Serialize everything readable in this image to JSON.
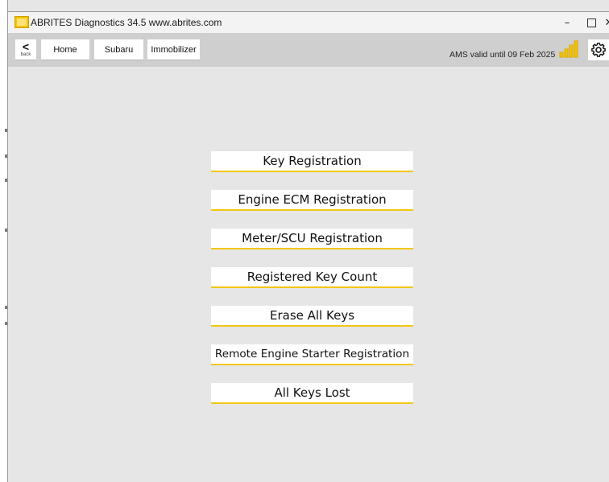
{
  "window": {
    "title": "ABRITES Diagnostics 34.5   www.abrites.com",
    "minimize": "–",
    "close": "✕"
  },
  "nav": {
    "back_label": "back",
    "back_arrow": "<",
    "breadcrumbs": [
      "Home",
      "Subaru",
      "Immobilizer"
    ],
    "ams_status": "AMS valid until 09 Feb 2025"
  },
  "signal": {
    "level": 1.0,
    "color": "#f0c000"
  },
  "colors": {
    "accent": "#f3c612",
    "background": "#e6e6e6",
    "toolbar": "#cfcfcf"
  },
  "menu": {
    "items": [
      {
        "label": "Key Registration"
      },
      {
        "label": "Engine ECM Registration"
      },
      {
        "label": "Meter/SCU Registration"
      },
      {
        "label": "Registered Key Count"
      },
      {
        "label": "Erase All Keys"
      },
      {
        "label": "Remote Engine Starter Registration"
      },
      {
        "label": "All Keys Lost"
      }
    ]
  },
  "icons": {
    "app": "abrites-logo-icon",
    "back": "chevron-left-icon",
    "signal": "signal-strength-icon",
    "settings": "gear-icon"
  }
}
